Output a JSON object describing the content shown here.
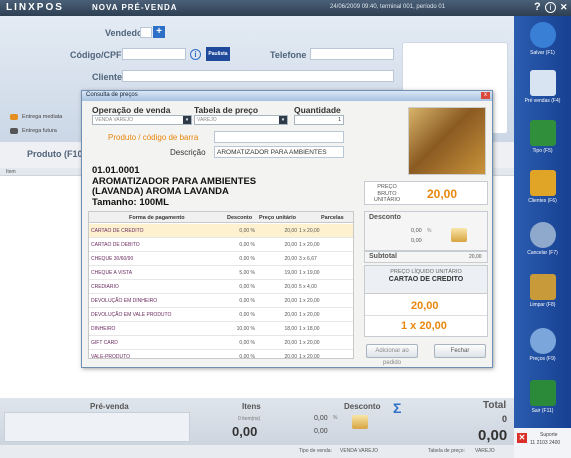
{
  "topbar": {
    "logo": "LINXPOS",
    "title": "NOVA PRÉ-VENDA",
    "status": "24/06/2009 09:40, terminal 001, período 01",
    "help": "?",
    "info": "i",
    "close": "✕"
  },
  "form": {
    "vendedor_label": "Vendedor",
    "codigo_label": "Código/CPF",
    "paulista_label": "Paulista",
    "telefone_label": "Telefone",
    "cliente_label": "Cliente",
    "entrega_mediata": "Entrega mediata",
    "entrega_futura": "Entrega futura",
    "produto_label": "Produto (F10)",
    "item_header": "Item"
  },
  "sidebar": [
    {
      "label": "Salvar (F1)",
      "color": "#3a7fd6"
    },
    {
      "label": "Pré vendas (F4)",
      "color": "#d9e4f2"
    },
    {
      "label": "Tipo (F5)",
      "color": "#2f8f3a"
    },
    {
      "label": "Clientes (F6)",
      "color": "#e0a526"
    },
    {
      "label": "Cancelar (F7)",
      "color": "#8fa9cc"
    },
    {
      "label": "Limpar (F8)",
      "color": "#c89a3a"
    },
    {
      "label": "Preços (F9)",
      "color": "#7aa6db"
    },
    {
      "label": "Sair (F11)",
      "color": "#2b8a3a"
    }
  ],
  "dialog": {
    "title": "Consulta de preços",
    "close": "x",
    "op_label": "Operação de venda",
    "op_value": "VENDA VAREJO",
    "tab_label": "Tabela de preço",
    "tab_value": "VAREJO",
    "qty_label": "Quantidade",
    "qty_value": "1",
    "barcode_label": "Produto / código de barra",
    "desc_label": "Descrição",
    "desc_value": "AROMATIZADOR PARA AMBIENTES",
    "code": "01.01.0001",
    "product_line1": "AROMATIZADOR PARA AMBIENTES",
    "product_line2": "(LAVANDA) AROMA LAVANDA",
    "product_line3": "Tamanho: 100ML",
    "gross_label": "Preço bruto unitário",
    "gross_value": "20,00",
    "discount_label": "Desconto",
    "disc_pct": "0,00",
    "disc_pct_sym": "%",
    "disc_val": "0,00",
    "subtotal_label": "Subtotal",
    "subtotal_value": "20,00",
    "net_label": "Preço líquido unitário",
    "net_method": "CARTAO DE CREDITO",
    "net_value": "20,00",
    "net_parcelas": "1 x 20,00",
    "add_button": "Adicionar ao pedido",
    "close_button": "Fechar",
    "table_headers": [
      "Forma de pagamento",
      "Desconto",
      "Preço unitário",
      "Parcelas"
    ],
    "rows": [
      [
        "CARTAO DE CREDITO",
        "0,00 %",
        "20,00",
        "1 x 20,00"
      ],
      [
        "CARTAO DE DEBITO",
        "0,00 %",
        "20,00",
        "1 x 20,00"
      ],
      [
        "CHEQUE 30/60/90",
        "0,00 %",
        "20,00",
        "3 x 6,67"
      ],
      [
        "CHEQUE A VISTA",
        "5,00 %",
        "19,00",
        "1 x 19,00"
      ],
      [
        "CREDIARIO",
        "0,00 %",
        "20,00",
        "5 x 4,00"
      ],
      [
        "DEVOLUÇÃO EM DINHEIRO",
        "0,00 %",
        "20,00",
        "1 x 20,00"
      ],
      [
        "DEVOLUÇÃO EM VALE PRODUTO",
        "0,00 %",
        "20,00",
        "1 x 20,00"
      ],
      [
        "DINHEIRO",
        "10,00 %",
        "18,00",
        "1 x 18,00"
      ],
      [
        "GIFT CARD",
        "0,00 %",
        "20,00",
        "1 x 20,00"
      ],
      [
        "VALE-PRODUTO",
        "0,00 %",
        "20,00",
        "1 x 20,00"
      ]
    ]
  },
  "bottom": {
    "prevenda_label": "Pré-venda",
    "itens_label": "Itens",
    "itens_sub": "0 item(ns)",
    "itens_value": "0,00",
    "desconto_label": "Desconto",
    "desc_pct": "0,00",
    "desc_pct_sym": "%",
    "desc_value": "0,00",
    "total_label": "Total",
    "total_count": "0",
    "total_value": "0,00",
    "sigma": "Σ",
    "suporte": "Suporte",
    "phone": "11 2103 2400"
  },
  "footer": {
    "tipo_label": "Tipo de venda:",
    "tipo_value": "VENDA VAREJO",
    "tabela_label": "Tabela de preço:",
    "tabela_value": "VAREJO"
  }
}
